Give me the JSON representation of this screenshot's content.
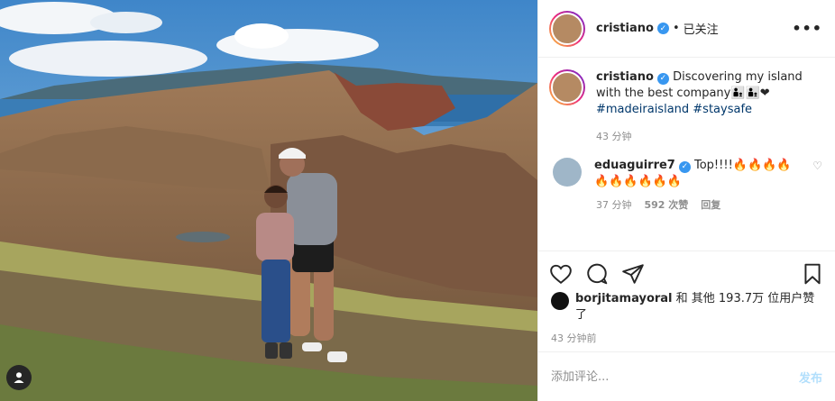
{
  "post": {
    "username": "cristiano",
    "verified_icon": "verified-badge-icon",
    "separator": "•",
    "follow_state": "已关注",
    "more_icon": "more-options-icon"
  },
  "caption": {
    "username": "cristiano",
    "text": " Discovering my island with the best company👨‍👦👨‍👦❤",
    "hashtags": "#madeiraisland #staysafe",
    "time": "43 分钟"
  },
  "comment": {
    "username": "eduaguirre7",
    "text": " Top!!!!🔥🔥🔥🔥🔥🔥🔥🔥🔥🔥",
    "time": "37 分钟",
    "likes": "592 次赞",
    "reply": "回复"
  },
  "likes": {
    "user": "borjitamayoral",
    "rest": " 和 其他 193.7万 位用户赞了"
  },
  "timestamp": "43 分钟前",
  "composer": {
    "placeholder": "添加评论...",
    "post_label": "发布"
  },
  "colors": {
    "link": "#00376b",
    "muted": "#8e8e8e",
    "post_disabled": "#b2dffc",
    "verified": "#3897f0"
  }
}
